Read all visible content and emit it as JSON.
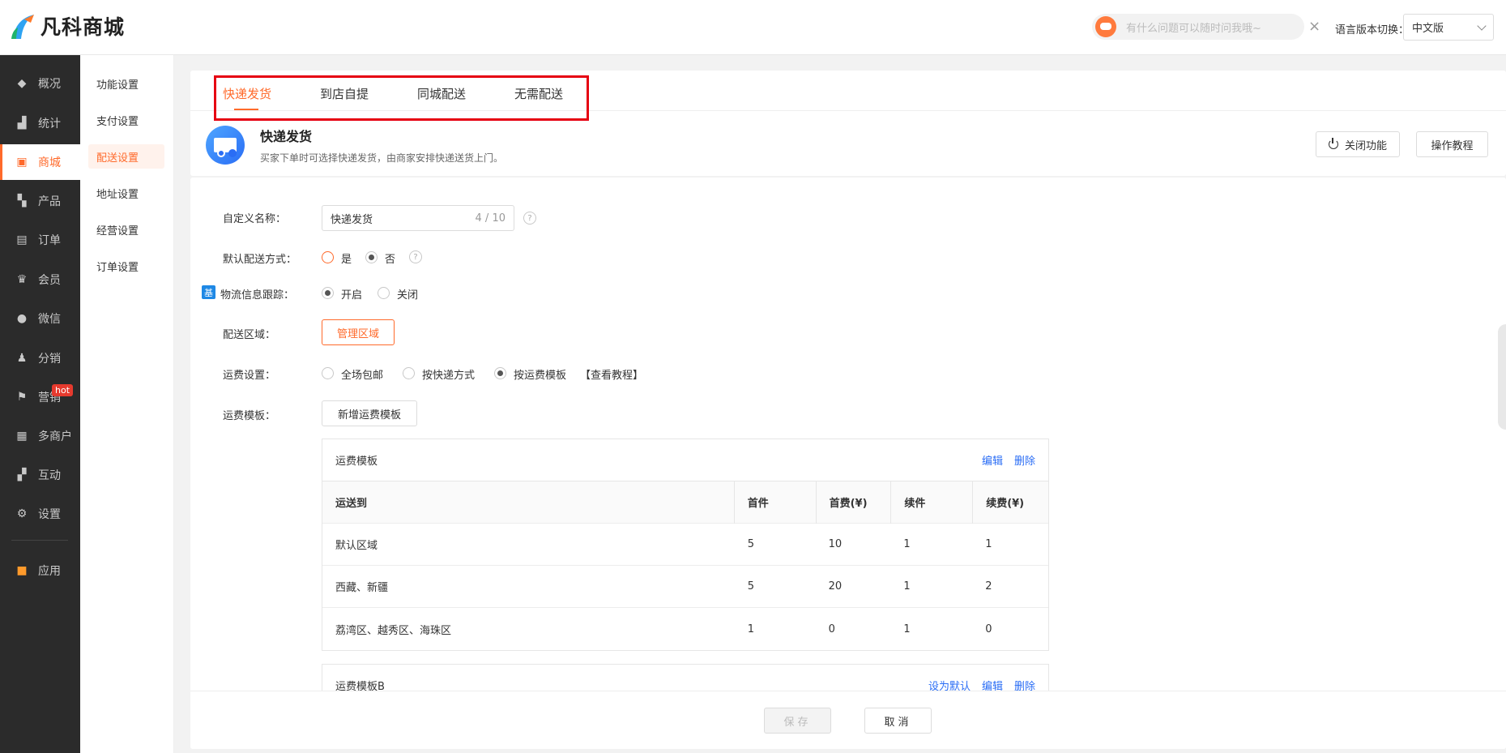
{
  "header": {
    "logo_text": "凡科商城",
    "ai_placeholder": "有什么问题可以随时问我哦~",
    "close_glyph": "×",
    "lang_label": "语言版本切换：",
    "lang_value": "中文版"
  },
  "sidebar": {
    "items": [
      {
        "label": "概况",
        "icon": "layers-icon"
      },
      {
        "label": "统计",
        "icon": "chart-icon"
      },
      {
        "label": "商城",
        "icon": "shop-icon"
      },
      {
        "label": "产品",
        "icon": "grid-icon"
      },
      {
        "label": "订单",
        "icon": "clipboard-icon"
      },
      {
        "label": "会员",
        "icon": "crown-icon"
      },
      {
        "label": "微信",
        "icon": "wechat-icon"
      },
      {
        "label": "分销",
        "icon": "user-share-icon"
      },
      {
        "label": "营销",
        "icon": "flag-icon"
      },
      {
        "label": "多商户",
        "icon": "store-icon"
      },
      {
        "label": "互动",
        "icon": "interact-icon"
      },
      {
        "label": "设置",
        "icon": "gear-icon"
      },
      {
        "label": "应用",
        "icon": "apps-icon"
      }
    ],
    "hot_badge": "hot"
  },
  "subnav": {
    "items": [
      "功能设置",
      "支付设置",
      "配送设置",
      "地址设置",
      "经营设置",
      "订单设置"
    ]
  },
  "tabs": [
    "快递发货",
    "到店自提",
    "同城配送",
    "无需配送"
  ],
  "feature": {
    "title": "快递发货",
    "desc": "买家下单时可选择快递发货，由商家安排快递送货上门。",
    "close_btn": "关闭功能",
    "tutorial_btn": "操作教程"
  },
  "form": {
    "name_label": "自定义名称：",
    "name_value": "快递发货",
    "name_count": "4 / 10",
    "help_glyph": "?",
    "default_label": "默认配送方式：",
    "default_yes": "是",
    "default_no": "否",
    "track_badge": "基",
    "track_label": "物流信息跟踪：",
    "track_on": "开启",
    "track_off": "关闭",
    "area_label": "配送区域：",
    "area_btn": "管理区域",
    "fee_label": "运费设置：",
    "fee_opt1": "全场包邮",
    "fee_opt2": "按快递方式",
    "fee_opt3": "按运费模板",
    "fee_tutorial": "【查看教程】",
    "tpl_label": "运费模板：",
    "tpl_add_btn": "新增运费模板"
  },
  "templates": [
    {
      "name": "运费模板",
      "actions": [
        "编辑",
        "删除"
      ],
      "columns": [
        "运送到",
        "首件",
        "首费(¥)",
        "续件",
        "续费(¥)"
      ],
      "rows": [
        [
          "默认区域",
          "5",
          "10",
          "1",
          "1"
        ],
        [
          "西藏、新疆",
          "5",
          "20",
          "1",
          "2"
        ],
        [
          "荔湾区、越秀区、海珠区",
          "1",
          "0",
          "1",
          "0"
        ]
      ]
    },
    {
      "name": "运费模板B",
      "actions": [
        "设为默认",
        "编辑",
        "删除"
      ]
    }
  ],
  "footer": {
    "save": "保存",
    "cancel": "取消"
  }
}
